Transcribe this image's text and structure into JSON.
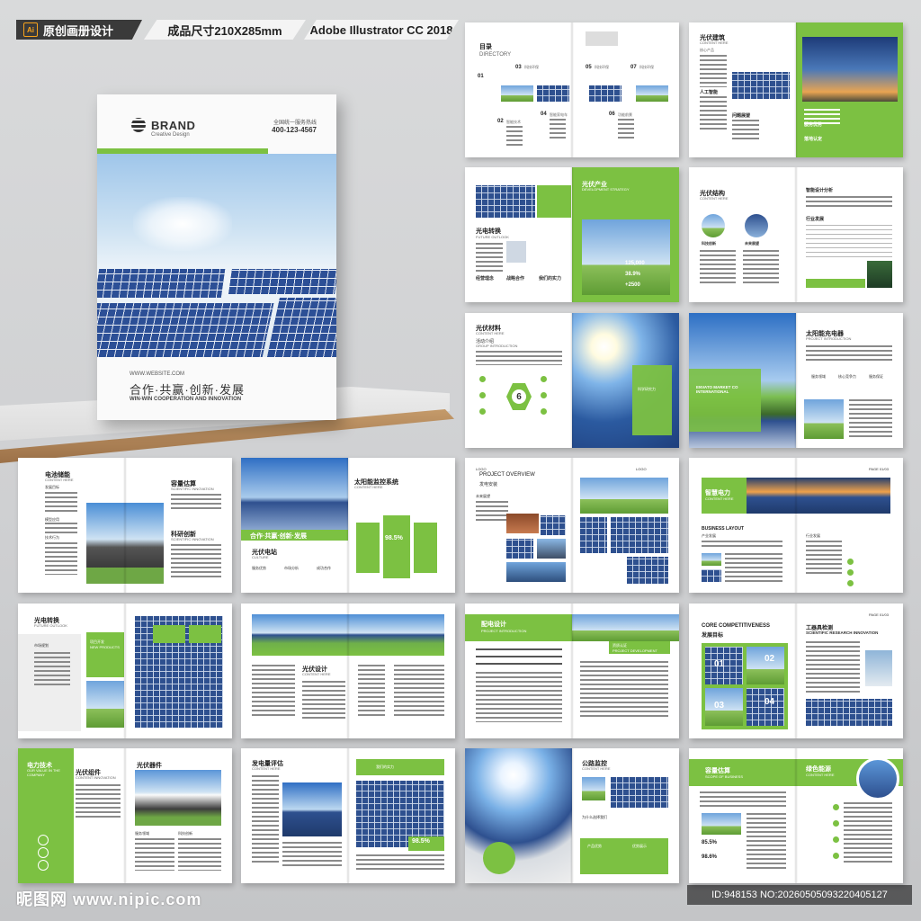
{
  "header": {
    "ai_badge": "Ai",
    "original_label": "原创画册设计",
    "size_label": "成品尺寸210X285mm",
    "software_label": "Adobe Illustrator CC 2018"
  },
  "cover": {
    "brand": "BRAND",
    "brand_sub": "Creative Design",
    "hotline_label": "全国统一服务热线",
    "phone": "400-123-4567",
    "website": "WWW.WEBSITE.COM",
    "slogan": "合作·共赢·创新·发展",
    "slogan_en": "WIN-WIN COOPERATION AND INNOVATION"
  },
  "spreads": {
    "s1": {
      "title": "目录",
      "sub": "DIRECTORY",
      "n1": "01",
      "n2": "02",
      "n3": "03",
      "n4": "04",
      "n5": "05",
      "n6": "06",
      "n7": "07",
      "i3": "科技环保",
      "i5": "科技环保",
      "i7": "科技环保",
      "i2": "智能技术",
      "i4": "智能家电车",
      "i6": "功能前景"
    },
    "s2": {
      "title": "光伏建筑",
      "sub": "CONTENT HERE",
      "a": "核心产品",
      "b": "人工智能",
      "c": "问题展望",
      "d": "服务优势",
      "e": "落地认定"
    },
    "s3": {
      "title": "光伏产业",
      "sub": "DEVELOPMENT STRATEGY",
      "t2": "光电转换",
      "t2sub": "FUTURE OUTLOOK",
      "n1": "125,000",
      "n2": "38.9%",
      "n3": "+2500",
      "a": "经营理念",
      "b": "战略合作",
      "c": "我们的实力"
    },
    "s4": {
      "title": "光伏结构",
      "sub": "CONTENT HERE",
      "t2": "智能设计分析",
      "a": "科技创新",
      "b": "未来展望",
      "c": "行业发展"
    },
    "s5": {
      "title": "光伏材料",
      "sub": "CONTENT HERE",
      "t2": "活动介绍",
      "t2sub": "GROUP INTRODUCTION",
      "num": "6",
      "box": "科学研究力"
    },
    "s6": {
      "title": "太阳能充电器",
      "sub": "PROJECT INTRODUCTION",
      "a": "服务领域",
      "b": "核心竞争力",
      "c": "服务保证",
      "over": "ENVATO MARKET CO INTERNATIONAL"
    },
    "s7": {
      "title": "电池储能",
      "sub": "CONTENT HERE",
      "a": "发展目标",
      "b": "模型应用",
      "c": "技术行为",
      "t2": "容量估算",
      "t2sub": "SCIENTIFIC INNOVATION",
      "t3": "科研创新",
      "t3sub": "SCIENTIFIC INNOVATION"
    },
    "s8": {
      "title": "太阳能监控系统",
      "sub": "CONTENT HERE",
      "banner": "合作·共赢·创新·发展",
      "t2": "光伏电站",
      "t2sub": "CULTURE",
      "pct": "98.5%",
      "a": "服务优势",
      "b": "市场分析",
      "c": "成功合作"
    },
    "s9": {
      "title": "PROJECT OVERVIEW",
      "sub": "发电安装",
      "logo": "LOGO",
      "a": "未来展望"
    },
    "s10": {
      "title": "智慧电力",
      "sub": "CONTENT HERE",
      "page": "PAGE 01/03",
      "t2": "BUSINESS LAYOUT",
      "a": "产业发展",
      "b": "行业发展"
    },
    "s11": {
      "title": "光电转换",
      "sub": "FUTURE OUTLOOK",
      "a": "市场规划",
      "b": "项目开发",
      "c": "NEW PRODUCTS"
    },
    "s12": {
      "title": "光伏设计",
      "sub": "CONTENT HERE"
    },
    "s13": {
      "title": "配电设计",
      "sub": "PROJECT INTRODUCTION",
      "t2": "资质认证",
      "t2sub": "PROJECT DEVELOPMENT"
    },
    "s14": {
      "title": "CORE COMPETITIVENESS",
      "sub": "发展目标",
      "t2": "工器具检测",
      "t2sub": "SCIENTIFIC RESEARCH INNOVATION",
      "page": "PAGE 01/03",
      "n1": "01",
      "n2": "02",
      "n3": "03",
      "n4": "04"
    },
    "s15": {
      "title": "电力技术",
      "sub": "OUR VALUE IN THE COMPANY",
      "t2": "光伏组件",
      "t2sub": "CONTENT INNOVATION",
      "t3": "光伏器件",
      "a": "服务领域",
      "b": "科技创新"
    },
    "s16": {
      "title": "发电量评估",
      "sub": "CONTENT HERE",
      "pct": "98.5%",
      "box": "我们的实力"
    },
    "s17": {
      "title": "公路监控",
      "sub": "CONTENT HERE",
      "a": "为什么选择我们",
      "b": "产品优势",
      "c": "优势展示"
    },
    "s18": {
      "title": "容量估算",
      "sub": "SCOPE OF BUSINESS",
      "t2": "绿色能源",
      "t2sub": "CONTENT HERE",
      "n1": "85.5%",
      "n2": "98.6%"
    }
  },
  "footer": {
    "watermark": "昵图网 www.nipic.com",
    "id_text": "ID:948153 NO:20260505093220405127"
  }
}
